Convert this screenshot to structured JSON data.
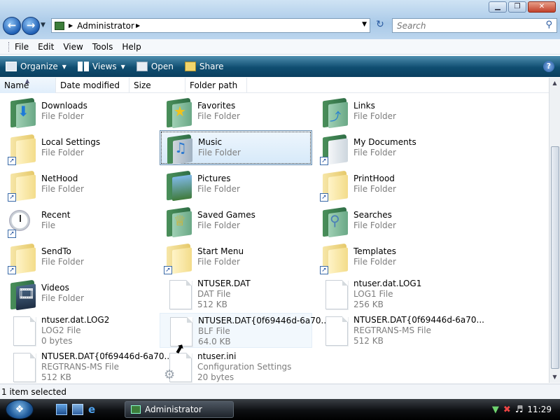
{
  "window": {
    "controls": {
      "minimize": "▁",
      "maximize": "❐",
      "close": "✕"
    },
    "address": {
      "crumb": "Administrator"
    },
    "search": {
      "placeholder": "Search"
    }
  },
  "menu": [
    {
      "label": "File"
    },
    {
      "label": "Edit"
    },
    {
      "label": "View"
    },
    {
      "label": "Tools"
    },
    {
      "label": "Help"
    }
  ],
  "toolbar": {
    "organize": "Organize",
    "views": "Views",
    "open": "Open",
    "share": "Share"
  },
  "columns": {
    "name": "Name",
    "date_modified": "Date modified",
    "size": "Size",
    "folder_path": "Folder path"
  },
  "items": [
    {
      "name": "Downloads",
      "type": "File Folder"
    },
    {
      "name": "Favorites",
      "type": "File Folder"
    },
    {
      "name": "Links",
      "type": "File Folder"
    },
    {
      "name": "Local Settings",
      "type": "File Folder"
    },
    {
      "name": "Music",
      "type": "File Folder"
    },
    {
      "name": "My Documents",
      "type": "File Folder"
    },
    {
      "name": "NetHood",
      "type": "File Folder"
    },
    {
      "name": "Pictures",
      "type": "File Folder"
    },
    {
      "name": "PrintHood",
      "type": "File Folder"
    },
    {
      "name": "Recent",
      "type": "File"
    },
    {
      "name": "Saved Games",
      "type": "File Folder"
    },
    {
      "name": "Searches",
      "type": "File Folder"
    },
    {
      "name": "SendTo",
      "type": "File Folder"
    },
    {
      "name": "Start Menu",
      "type": "File Folder"
    },
    {
      "name": "Templates",
      "type": "File Folder"
    },
    {
      "name": "Videos",
      "type": "File Folder"
    },
    {
      "name": "NTUSER.DAT",
      "type": "DAT File",
      "size": "512 KB"
    },
    {
      "name": "ntuser.dat.LOG1",
      "type": "LOG1 File",
      "size": "256 KB"
    },
    {
      "name": "ntuser.dat.LOG2",
      "type": "LOG2 File",
      "size": "0 bytes"
    },
    {
      "name": "NTUSER.DAT{0f69446d-6a70...",
      "type": "BLF File",
      "size": "64.0 KB"
    },
    {
      "name": "NTUSER.DAT{0f69446d-6a70...",
      "type": "REGTRANS-MS File",
      "size": "512 KB"
    },
    {
      "name": "NTUSER.DAT{0f69446d-6a70...",
      "type": "REGTRANS-MS File",
      "size": "512 KB"
    },
    {
      "name": "ntuser.ini",
      "type": "Configuration Settings",
      "size": "20 bytes"
    }
  ],
  "status": {
    "text": "1 item selected"
  },
  "taskbar": {
    "start": "❖",
    "window_button": "Administrator",
    "clock": "11:29"
  }
}
